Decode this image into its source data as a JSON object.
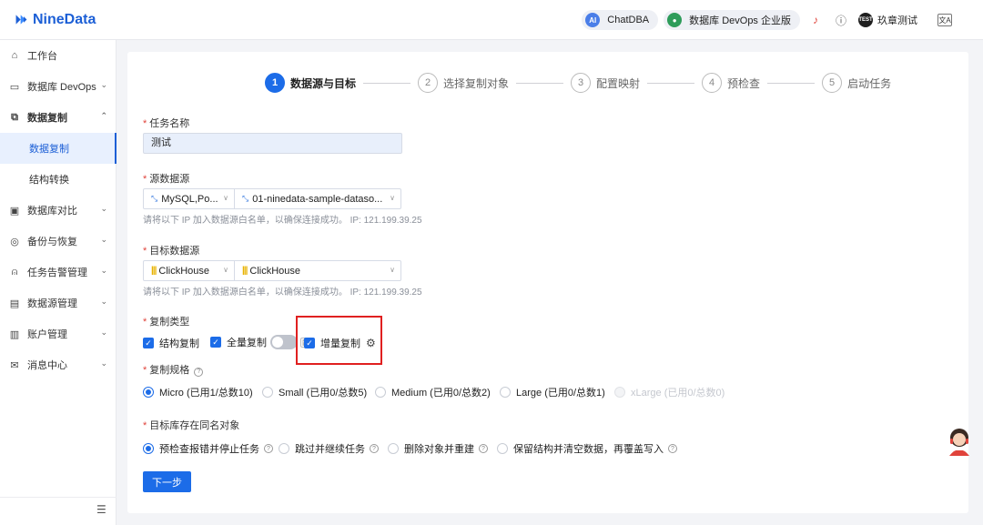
{
  "header": {
    "logo_text": "NineData",
    "chatdba_label": "ChatDBA",
    "chatdba_icon_text": "AI",
    "devops_label": "数据库 DevOps 企业版",
    "user_avatar_text": "TEST",
    "user_name": "玖章测试",
    "lang_icon_text": "文A"
  },
  "sidebar": {
    "items": [
      {
        "label": "工作台",
        "icon": "home-icon"
      },
      {
        "label": "数据库 DevOps",
        "icon": "devops-icon"
      },
      {
        "label": "数据复制",
        "icon": "replication-icon"
      },
      {
        "label": "数据复制"
      },
      {
        "label": "结构转换"
      },
      {
        "label": "数据库对比",
        "icon": "compare-icon"
      },
      {
        "label": "备份与恢复",
        "icon": "backup-icon"
      },
      {
        "label": "任务告警管理",
        "icon": "alert-icon"
      },
      {
        "label": "数据源管理",
        "icon": "datasource-icon"
      },
      {
        "label": "账户管理",
        "icon": "account-icon"
      },
      {
        "label": "消息中心",
        "icon": "message-icon"
      }
    ]
  },
  "steps": [
    {
      "num": "1",
      "label": "数据源与目标"
    },
    {
      "num": "2",
      "label": "选择复制对象"
    },
    {
      "num": "3",
      "label": "配置映射"
    },
    {
      "num": "4",
      "label": "预检查"
    },
    {
      "num": "5",
      "label": "启动任务"
    }
  ],
  "form": {
    "task_name_label": "任务名称",
    "task_name_value": "测试",
    "source_label": "源数据源",
    "source_type": "MySQL,Po...",
    "source_instance": "01-ninedata-sample-dataso...",
    "source_hint": "请将以下 IP 加入数据源白名单，以确保连接成功。 IP: 121.199.39.25",
    "target_label": "目标数据源",
    "target_type": "ClickHouse",
    "target_instance": "ClickHouse",
    "target_hint": "请将以下 IP 加入数据源白名单，以确保连接成功。 IP: 121.199.39.25",
    "copy_type_label": "复制类型",
    "copy_types": [
      "结构复制",
      "全量复制",
      "增量复制"
    ],
    "spec_label": "复制规格",
    "specs": [
      {
        "label": "Micro (已用1/总数10)",
        "selected": true,
        "disabled": false
      },
      {
        "label": "Small (已用0/总数5)",
        "selected": false,
        "disabled": false
      },
      {
        "label": "Medium (已用0/总数2)",
        "selected": false,
        "disabled": false
      },
      {
        "label": "Large (已用0/总数1)",
        "selected": false,
        "disabled": false
      },
      {
        "label": "xLarge (已用0/总数0)",
        "selected": false,
        "disabled": true
      }
    ],
    "conflict_label": "目标库存在同名对象",
    "conflict_options": [
      {
        "label": "预检查报错并停止任务",
        "selected": true
      },
      {
        "label": "跳过并继续任务",
        "selected": false
      },
      {
        "label": "删除对象并重建",
        "selected": false
      },
      {
        "label": "保留结构并清空数据，再覆盖写入",
        "selected": false
      }
    ],
    "next_button": "下一步"
  },
  "colors": {
    "brand": "#1c5fd6",
    "primary": "#1c6ce8",
    "highlight": "#e02020"
  }
}
